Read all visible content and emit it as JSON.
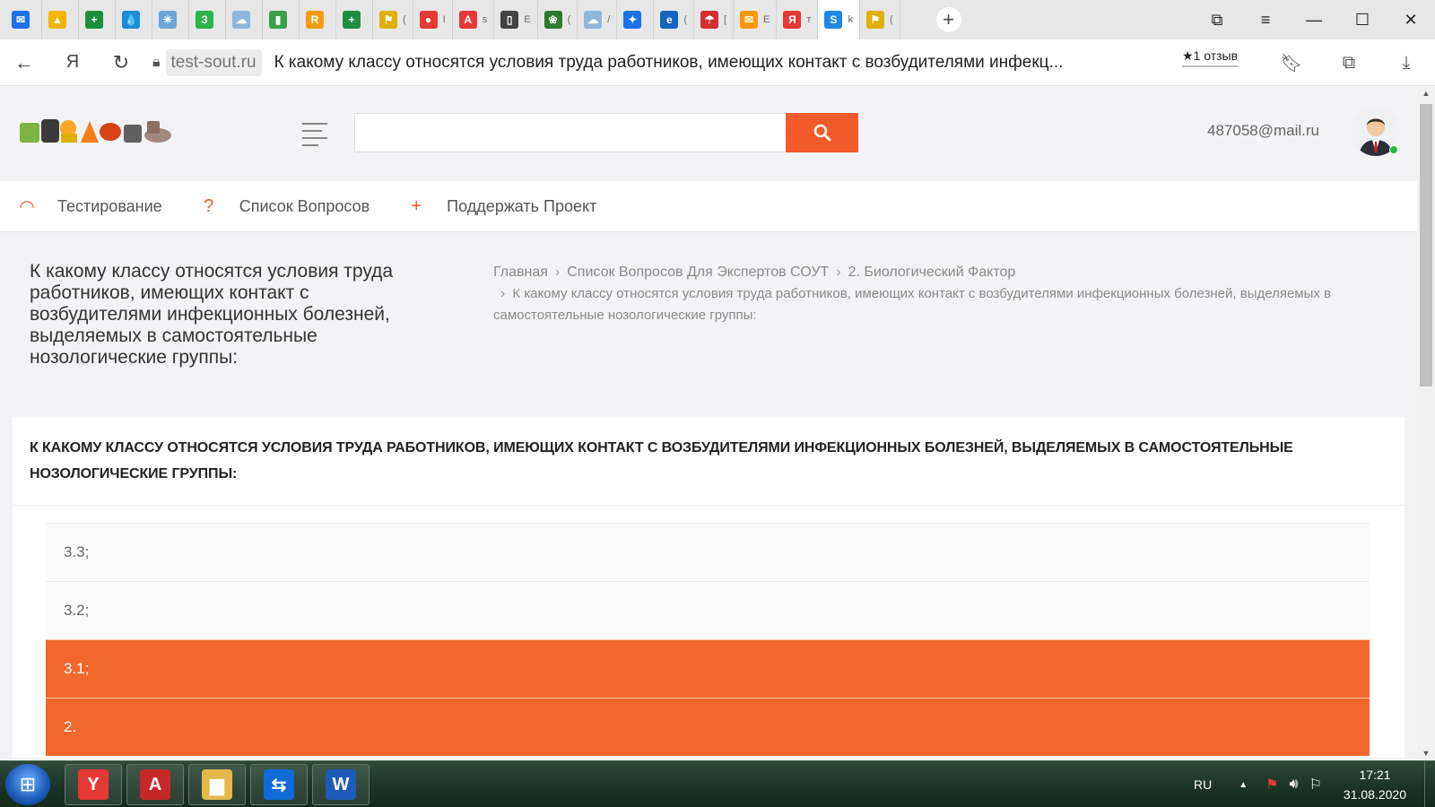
{
  "browser": {
    "tabs": [
      {
        "icon": "mail-icon",
        "color": "#1a73e8",
        "glyph": "✉",
        "title": ""
      },
      {
        "icon": "drive-icon",
        "color": "#f4b400",
        "glyph": "▲",
        "title": ""
      },
      {
        "icon": "sheets-plus-icon",
        "color": "#1e8e3e",
        "glyph": "+",
        "title": ""
      },
      {
        "icon": "drop-icon",
        "color": "#1a8cd8",
        "glyph": "💧",
        "title": ""
      },
      {
        "icon": "tool-icon",
        "color": "#6ea6d8",
        "glyph": "✳",
        "title": ""
      },
      {
        "icon": "letter-z-icon",
        "color": "#2db34a",
        "glyph": "З",
        "title": ""
      },
      {
        "icon": "weather-icon",
        "color": "#8fb7d9",
        "glyph": "☁",
        "title": ""
      },
      {
        "icon": "book-icon",
        "color": "#3aa04a",
        "glyph": "▮",
        "title": ""
      },
      {
        "icon": "r-icon",
        "color": "#f39c12",
        "glyph": "R",
        "title": ""
      },
      {
        "icon": "sheets-plus-icon",
        "color": "#1e8e3e",
        "glyph": "+",
        "title": ""
      },
      {
        "icon": "workwear-icon",
        "color": "#e0b000",
        "glyph": "⚑",
        "title": "("
      },
      {
        "icon": "map-pin-icon",
        "color": "#e53935",
        "glyph": "●",
        "title": "I"
      },
      {
        "icon": "pdf-icon",
        "color": "#e53935",
        "glyph": "A",
        "title": "s"
      },
      {
        "icon": "document-icon",
        "color": "#444444",
        "glyph": "▯",
        "title": "E"
      },
      {
        "icon": "clover-icon",
        "color": "#2a7d2a",
        "glyph": "❀",
        "title": "("
      },
      {
        "icon": "weather-icon",
        "color": "#8fb7d9",
        "glyph": "☁",
        "title": "/"
      },
      {
        "icon": "puzzle-icon",
        "color": "#1a73e8",
        "glyph": "✦",
        "title": ""
      },
      {
        "icon": "e-icon",
        "color": "#1565c0",
        "glyph": "e",
        "title": "("
      },
      {
        "icon": "umbrella-icon",
        "color": "#d32f2f",
        "glyph": "☂",
        "title": "["
      },
      {
        "icon": "envelope-icon",
        "color": "#ff9800",
        "glyph": "✉",
        "title": "E"
      },
      {
        "icon": "yandex-icon",
        "color": "#e53935",
        "glyph": "Я",
        "title": "т"
      },
      {
        "icon": "s-icon",
        "color": "#1e88e5",
        "glyph": "S",
        "title": "k"
      },
      {
        "icon": "workwear-icon",
        "color": "#e0b000",
        "glyph": "⚑",
        "title": "("
      }
    ],
    "active_tab_index": 21,
    "domain": "test-sout.ru",
    "page_title": "К какому классу относятся условия труда работников, имеющих контакт с возбудителями инфекц...",
    "reviews_label": "★1 отзыв"
  },
  "site": {
    "search_placeholder": "",
    "user_email": "487058@mail.ru",
    "menu": [
      {
        "icon": "dashboard-icon",
        "glyph": "◠",
        "label": "Тестирование"
      },
      {
        "icon": "question-icon",
        "glyph": "?",
        "label": "Список Вопросов"
      },
      {
        "icon": "plus-icon",
        "glyph": "+",
        "label": "Поддержать Проект"
      }
    ]
  },
  "page": {
    "title": "К какому классу относятся условия труда работников, имеющих контакт с возбудителями инфекционных болезней, выделяемых в самостоятельные нозологические группы:",
    "breadcrumb": {
      "home": "Главная",
      "level1": "Список Вопросов Для Экспертов СОУТ",
      "level2": "2. Биологический Фактор",
      "current": "К какому классу относятся условия труда работников, имеющих контакт с возбудителями инфекционных болезней, выделяемых в самостоятельные нозологические группы:"
    },
    "question": "К какому классу относятся условия труда работников, имеющих контакт с возбудителями инфекционных болезней, выделяемых в самостоятельные нозологические группы:",
    "answers": [
      {
        "text": "3.3;",
        "selected": false
      },
      {
        "text": "3.2;",
        "selected": false
      },
      {
        "text": "3.1;",
        "selected": true
      },
      {
        "text": "2.",
        "selected": true
      }
    ],
    "accent_color": "#f0682d"
  },
  "taskbar": {
    "apps": [
      {
        "icon": "yandex-browser-icon",
        "color": "#e53935",
        "glyph": "Y"
      },
      {
        "icon": "acrobat-icon",
        "color": "#c62828",
        "glyph": "A"
      },
      {
        "icon": "folder-icon",
        "color": "#e6b84a",
        "glyph": "▆"
      },
      {
        "icon": "teamviewer-icon",
        "color": "#0e6bd8",
        "glyph": "⇆"
      },
      {
        "icon": "word-icon",
        "color": "#1e5bb8",
        "glyph": "W"
      }
    ],
    "language": "RU",
    "time": "17:21",
    "date": "31.08.2020"
  }
}
